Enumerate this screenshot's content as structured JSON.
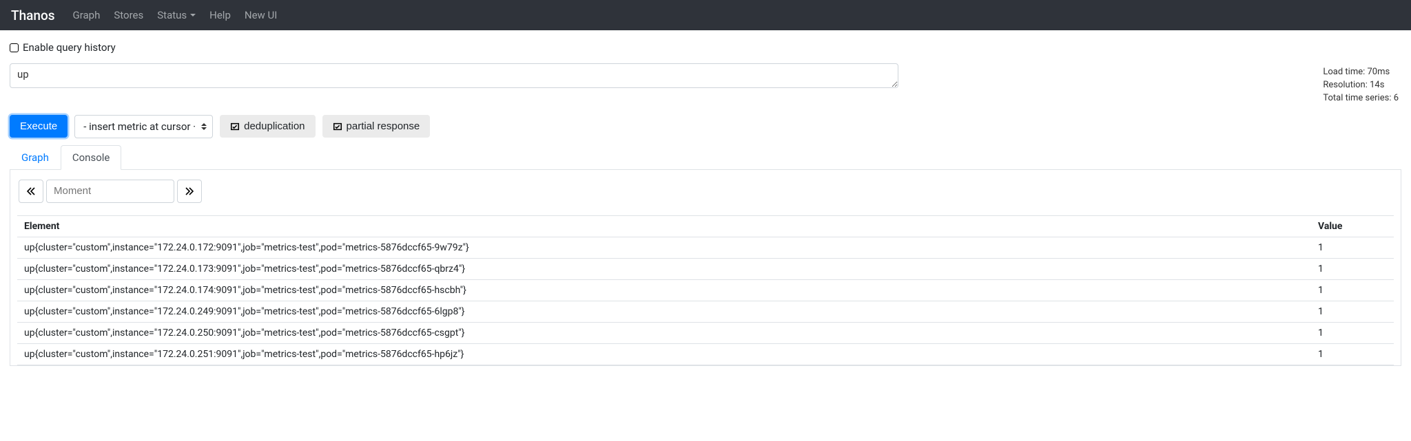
{
  "navbar": {
    "brand": "Thanos",
    "items": [
      "Graph",
      "Stores",
      "Status",
      "Help",
      "New UI"
    ]
  },
  "history": {
    "label": "Enable query history"
  },
  "query": {
    "value": "up"
  },
  "stats": {
    "load_time": "Load time: 70ms",
    "resolution": "Resolution: 14s",
    "total_series": "Total time series: 6"
  },
  "controls": {
    "execute": "Execute",
    "metric_placeholder": "- insert metric at cursor · ",
    "dedup": "deduplication",
    "partial": "partial response"
  },
  "tabs": {
    "graph": "Graph",
    "console": "Console"
  },
  "moment": {
    "placeholder": "Moment"
  },
  "table": {
    "headers": {
      "element": "Element",
      "value": "Value"
    },
    "rows": [
      {
        "element": "up{cluster=\"custom\",instance=\"172.24.0.172:9091\",job=\"metrics-test\",pod=\"metrics-5876dccf65-9w79z\"}",
        "value": "1"
      },
      {
        "element": "up{cluster=\"custom\",instance=\"172.24.0.173:9091\",job=\"metrics-test\",pod=\"metrics-5876dccf65-qbrz4\"}",
        "value": "1"
      },
      {
        "element": "up{cluster=\"custom\",instance=\"172.24.0.174:9091\",job=\"metrics-test\",pod=\"metrics-5876dccf65-hscbh\"}",
        "value": "1"
      },
      {
        "element": "up{cluster=\"custom\",instance=\"172.24.0.249:9091\",job=\"metrics-test\",pod=\"metrics-5876dccf65-6lgp8\"}",
        "value": "1"
      },
      {
        "element": "up{cluster=\"custom\",instance=\"172.24.0.250:9091\",job=\"metrics-test\",pod=\"metrics-5876dccf65-csgpt\"}",
        "value": "1"
      },
      {
        "element": "up{cluster=\"custom\",instance=\"172.24.0.251:9091\",job=\"metrics-test\",pod=\"metrics-5876dccf65-hp6jz\"}",
        "value": "1"
      }
    ]
  }
}
